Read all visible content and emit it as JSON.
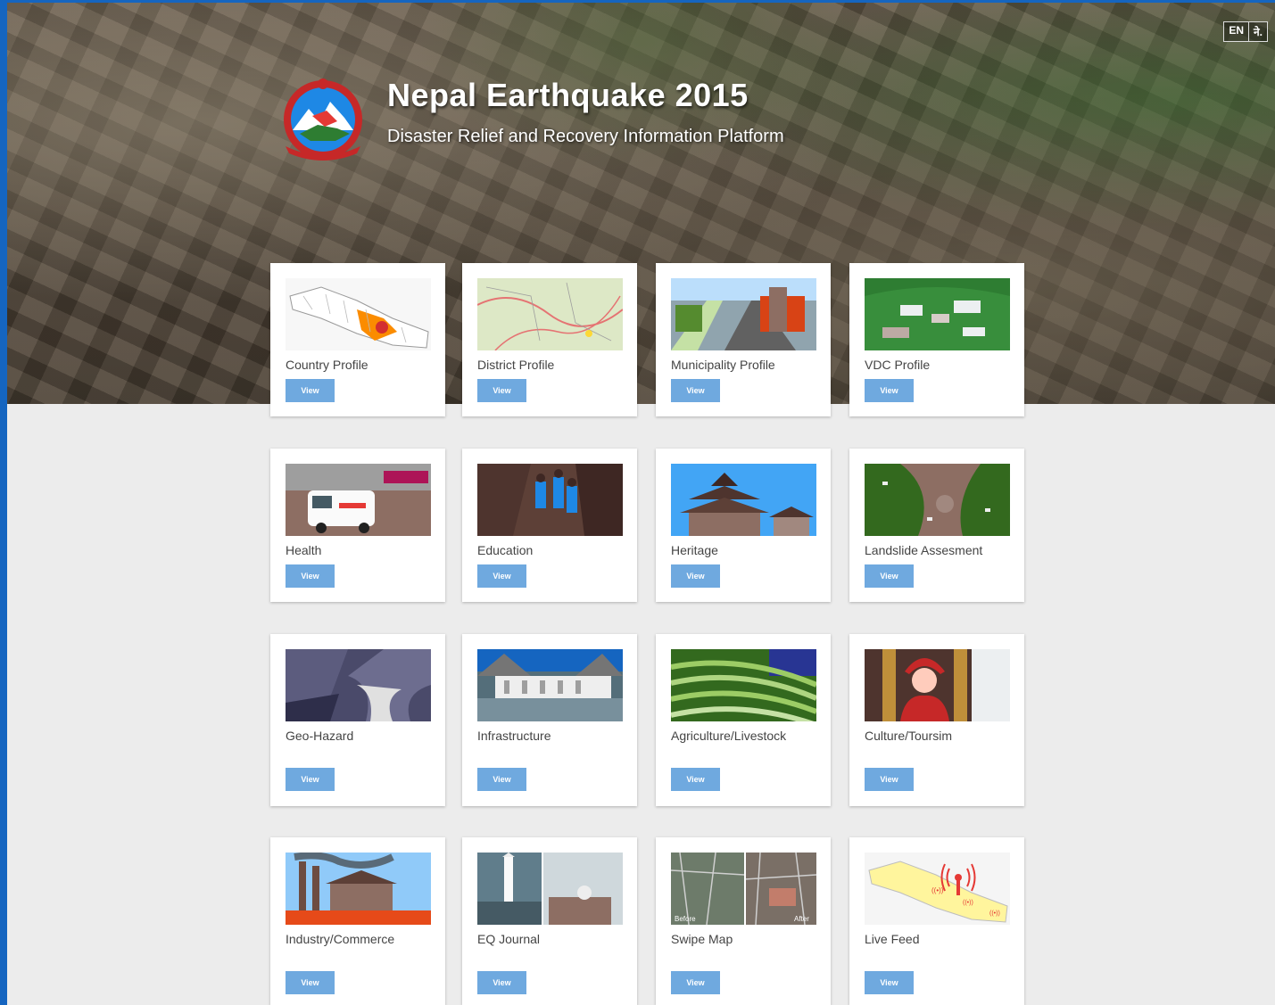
{
  "hero": {
    "title": "Nepal Earthquake 2015",
    "subtitle": "Disaster Relief and Recovery Information Platform",
    "emblem_name": "nepal-government-emblem",
    "lang": [
      "EN",
      "ने."
    ]
  },
  "view_label": "View",
  "cards": [
    {
      "label": "Country Profile",
      "thumb": "nepal-map-thumbnail"
    },
    {
      "label": "District Profile",
      "thumb": "district-map-thumbnail"
    },
    {
      "label": "Municipality Profile",
      "thumb": "city-road-thumbnail"
    },
    {
      "label": "VDC Profile",
      "thumb": "village-hills-thumbnail"
    },
    {
      "label": "Health",
      "thumb": "ambulance-thumbnail"
    },
    {
      "label": "Education",
      "thumb": "students-thumbnail"
    },
    {
      "label": "Heritage",
      "thumb": "temple-thumbnail"
    },
    {
      "label": "Landslide Assesment",
      "thumb": "landslide-thumbnail"
    },
    {
      "label": "Geo-Hazard",
      "thumb": "satellite-terrain-thumbnail"
    },
    {
      "label": "Infrastructure",
      "thumb": "dam-thumbnail"
    },
    {
      "label": "Agriculture/Livestock",
      "thumb": "terraces-thumbnail"
    },
    {
      "label": "Culture/Toursim",
      "thumb": "kumari-thumbnail"
    },
    {
      "label": "Industry/Commerce",
      "thumb": "brick-kiln-thumbnail"
    },
    {
      "label": "EQ Journal",
      "thumb": "tower-thumbnail"
    },
    {
      "label": "Swipe Map",
      "thumb": "before-after-map-thumbnail",
      "before": "Before",
      "after": "After"
    },
    {
      "label": "Live Feed",
      "thumb": "live-feed-map-thumbnail"
    }
  ],
  "colors": {
    "accent": "#6fa9df",
    "frame": "#1565c0"
  }
}
